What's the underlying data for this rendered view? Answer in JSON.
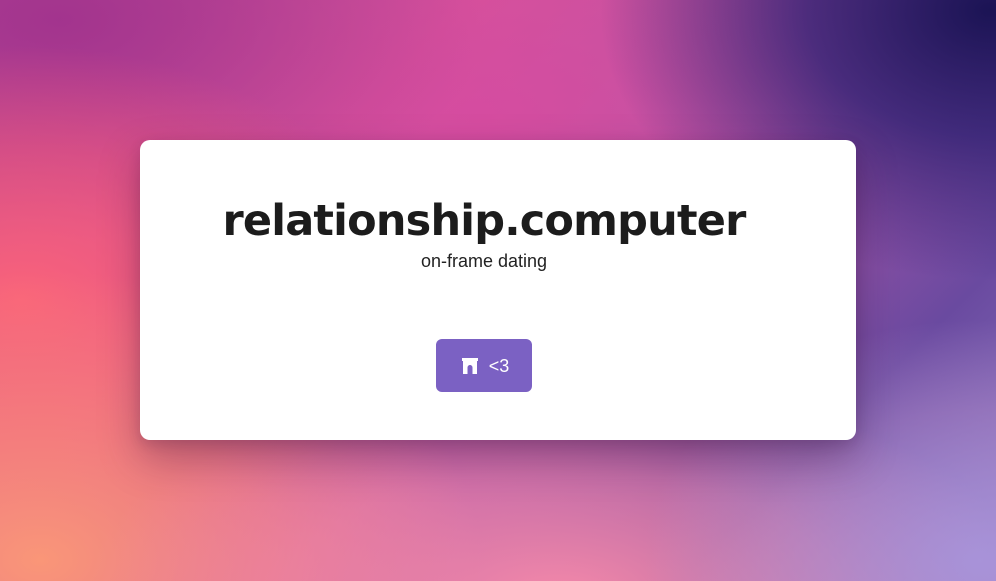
{
  "card": {
    "title": "relationship.computer",
    "subtitle": "on-frame dating"
  },
  "action": {
    "icon": "farcaster-arch-icon",
    "label": "<3"
  },
  "colors": {
    "button_background": "#7b61c3",
    "card_background": "#ffffff",
    "title_text": "#1c1c1c"
  }
}
